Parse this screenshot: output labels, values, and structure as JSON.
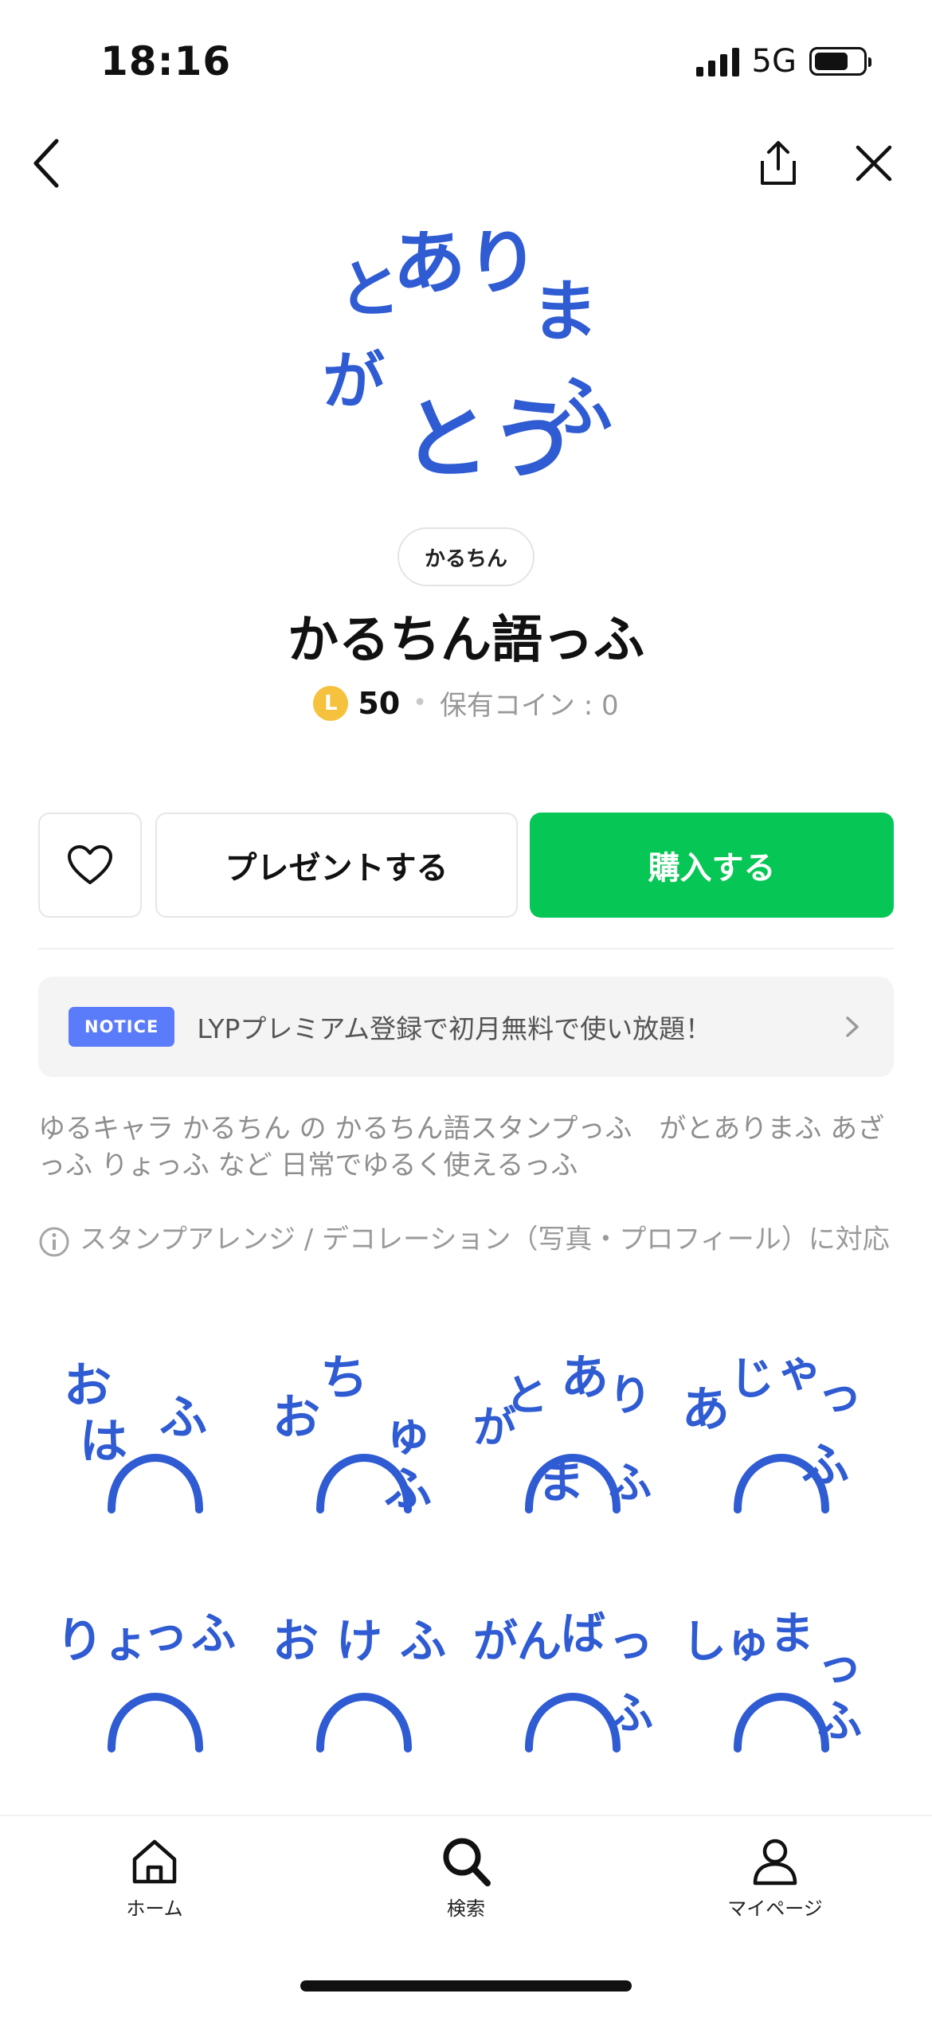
{
  "status_bar": {
    "time": "18:16",
    "network": "5G"
  },
  "nav": {
    "back_icon": "chevron-left-icon",
    "share_icon": "share-icon",
    "close_icon": "close-icon"
  },
  "product": {
    "author": "かるちん",
    "title": "かるちん語っふ",
    "coin_letter": "L",
    "price": "50",
    "separator": "•",
    "owned_coins": "保有コイン : 0",
    "hero_text": [
      "と",
      "あり",
      "ま",
      "が",
      "とう",
      "ふ"
    ]
  },
  "actions": {
    "gift_label": "プレゼントする",
    "buy_label": "購入する",
    "buy_color": "#06c755"
  },
  "notice": {
    "badge": "NOTICE",
    "text": "LYPプレミアム登録で初月無料で使い放題！",
    "badge_color": "#5b7cfa"
  },
  "description": "ゆるキャラ かるちん の かるちん語スタンプっふ　がとありまふ あざっふ りょっふ など 日常でゆるく使えるっふ",
  "arrange_note": "スタンプアレンジ / デコレーション（写真・プロフィール）に対応",
  "stickers": [
    {
      "name": "sticker-ohafu",
      "text": "おはふ"
    },
    {
      "name": "sticker-ochuf",
      "text": "おちゅふ"
    },
    {
      "name": "sticker-gatoarimafu",
      "text": "がとありまふ"
    },
    {
      "name": "sticker-ajaffu",
      "text": "あじゃっふ"
    },
    {
      "name": "sticker-ryoffu",
      "text": "りょっふ"
    },
    {
      "name": "sticker-okefu",
      "text": "おけふ"
    },
    {
      "name": "sticker-ganbaffu",
      "text": "がんばっふ"
    },
    {
      "name": "sticker-shumaffu",
      "text": "しゅまっふ"
    }
  ],
  "tabbar": {
    "home": "ホーム",
    "search": "検索",
    "mypage": "マイページ"
  },
  "colors": {
    "sticker_blue": "#2f5bd3",
    "coin": "#f6c13c"
  }
}
